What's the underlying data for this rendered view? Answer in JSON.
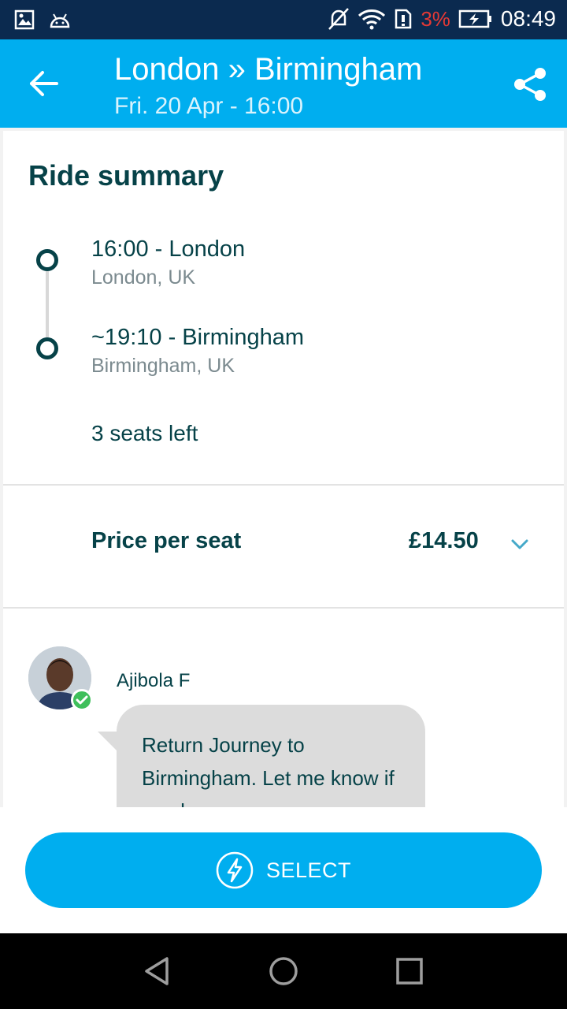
{
  "status_bar": {
    "battery_percent": "3%",
    "time": "08:49",
    "icons": [
      "gallery-icon",
      "android-icon",
      "mute-icon",
      "wifi-icon",
      "sim-icon",
      "battery-charging-icon"
    ]
  },
  "header": {
    "title": "London » Birmingham",
    "subtitle": "Fri. 20 Apr - 16:00"
  },
  "ride_summary": {
    "heading": "Ride summary",
    "stops": [
      {
        "main": "16:00 - London",
        "sub": "London, UK"
      },
      {
        "main": "~19:10 - Birmingham",
        "sub": "Birmingham, UK"
      }
    ],
    "seats_left": "3 seats left"
  },
  "price": {
    "label": "Price per seat",
    "value": "£14.50"
  },
  "driver": {
    "name": "Ajibola F",
    "message": "Return Journey to Birmingham. Let me know if you have"
  },
  "action": {
    "select_label": "SELECT"
  },
  "colors": {
    "accent": "#00aeef",
    "text_dark": "#064248",
    "status_bar": "#0b2a4f"
  }
}
